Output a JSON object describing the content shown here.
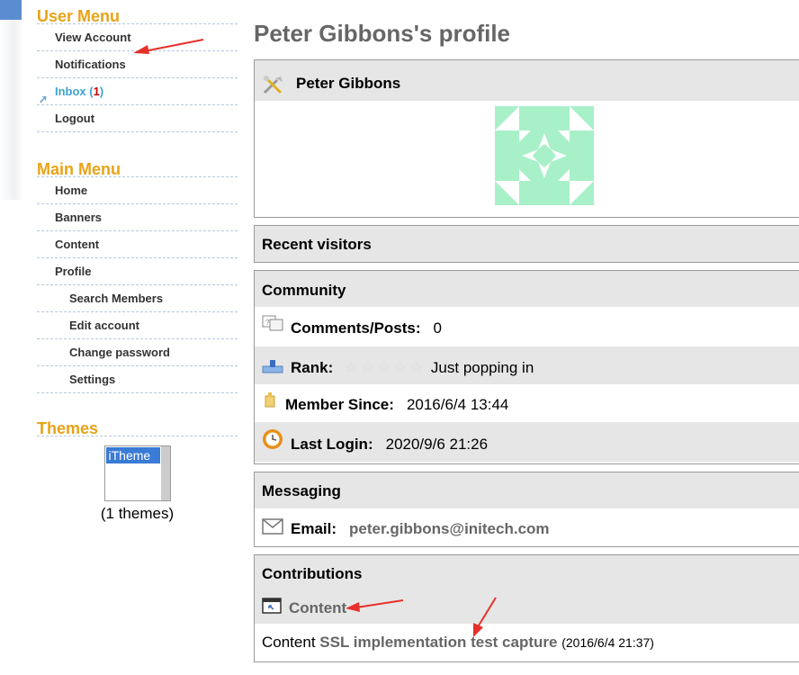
{
  "user_menu": {
    "title": "User Menu",
    "items": [
      {
        "label": "View Account"
      },
      {
        "label": "Notifications"
      },
      {
        "label": "Inbox",
        "count": "1"
      },
      {
        "label": "Logout"
      }
    ]
  },
  "main_menu": {
    "title": "Main Menu",
    "items": [
      {
        "label": "Home"
      },
      {
        "label": "Banners"
      },
      {
        "label": "Content"
      },
      {
        "label": "Profile"
      }
    ],
    "sub_items": [
      {
        "label": "Search Members"
      },
      {
        "label": "Edit account"
      },
      {
        "label": "Change password"
      },
      {
        "label": "Settings"
      }
    ]
  },
  "themes": {
    "title": "Themes",
    "selected": "iTheme",
    "count_text": "(1 themes)"
  },
  "profile": {
    "page_title": "Peter Gibbons's profile",
    "name": "Peter Gibbons",
    "recent_visitors_title": "Recent visitors",
    "community": {
      "title": "Community",
      "comments_label": "Comments/Posts:",
      "comments_value": "0",
      "rank_label": "Rank:",
      "rank_text": "Just popping in",
      "rank_stars": 0,
      "member_since_label": "Member Since:",
      "member_since_value": "2016/6/4 13:44",
      "last_login_label": "Last Login:",
      "last_login_value": "2020/9/6 21:26"
    },
    "messaging": {
      "title": "Messaging",
      "email_label": "Email:",
      "email_value": "peter.gibbons@initech.com"
    },
    "contributions": {
      "title": "Contributions",
      "section_label": "Content",
      "item_prefix": "Content",
      "item_link": "SSL implementation test capture",
      "item_date": "(2016/6/4 21:37)"
    }
  },
  "colors": {
    "menu_title": "#e8a317",
    "inbox_link": "#3ba3d0",
    "inbox_count": "#cc0000",
    "avatar": "#a8f0c8",
    "annotation_arrow": "#e8302a"
  }
}
